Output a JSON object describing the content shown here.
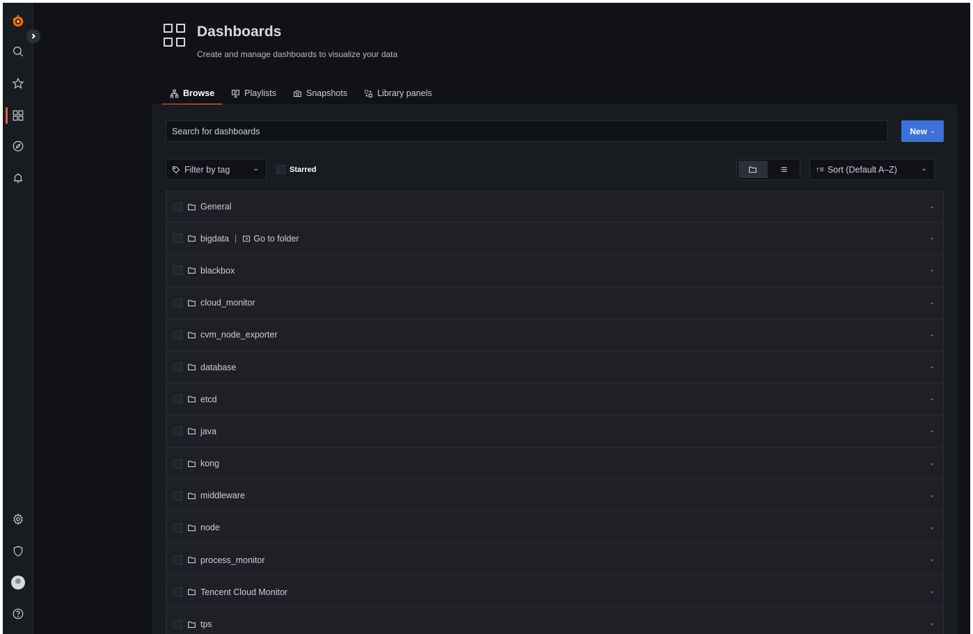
{
  "sidebar": {
    "top_icons": [
      "grafana-logo",
      "search-icon",
      "star-icon",
      "dashboards-icon",
      "explore-icon",
      "alerting-icon"
    ],
    "bottom_icons": [
      "gear-icon",
      "shield-icon",
      "avatar",
      "help-icon"
    ],
    "accent_color": "#f55f3e"
  },
  "header": {
    "title": "Dashboards",
    "subtitle": "Create and manage dashboards to visualize your data"
  },
  "tabs": [
    {
      "label": "Browse",
      "icon": "sitemap-icon",
      "active": true
    },
    {
      "label": "Playlists",
      "icon": "presentation-icon",
      "active": false
    },
    {
      "label": "Snapshots",
      "icon": "camera-icon",
      "active": false
    },
    {
      "label": "Library panels",
      "icon": "library-panels-icon",
      "active": false
    }
  ],
  "search": {
    "placeholder": "Search for dashboards"
  },
  "new_button": {
    "label": "New",
    "color": "#3d71d9"
  },
  "filters": {
    "tag_placeholder": "Filter by tag",
    "starred_label": "Starred",
    "sort_label": "Sort (Default A–Z)",
    "view_mode": "folders"
  },
  "folders": [
    {
      "name": "General"
    },
    {
      "name": "bigdata",
      "goto": "Go to folder"
    },
    {
      "name": "blackbox"
    },
    {
      "name": "cloud_monitor"
    },
    {
      "name": "cvm_node_exporter"
    },
    {
      "name": "database"
    },
    {
      "name": "etcd"
    },
    {
      "name": "java"
    },
    {
      "name": "kong"
    },
    {
      "name": "middleware"
    },
    {
      "name": "node"
    },
    {
      "name": "process_monitor"
    },
    {
      "name": "Tencent Cloud Monitor"
    },
    {
      "name": "tps"
    }
  ]
}
